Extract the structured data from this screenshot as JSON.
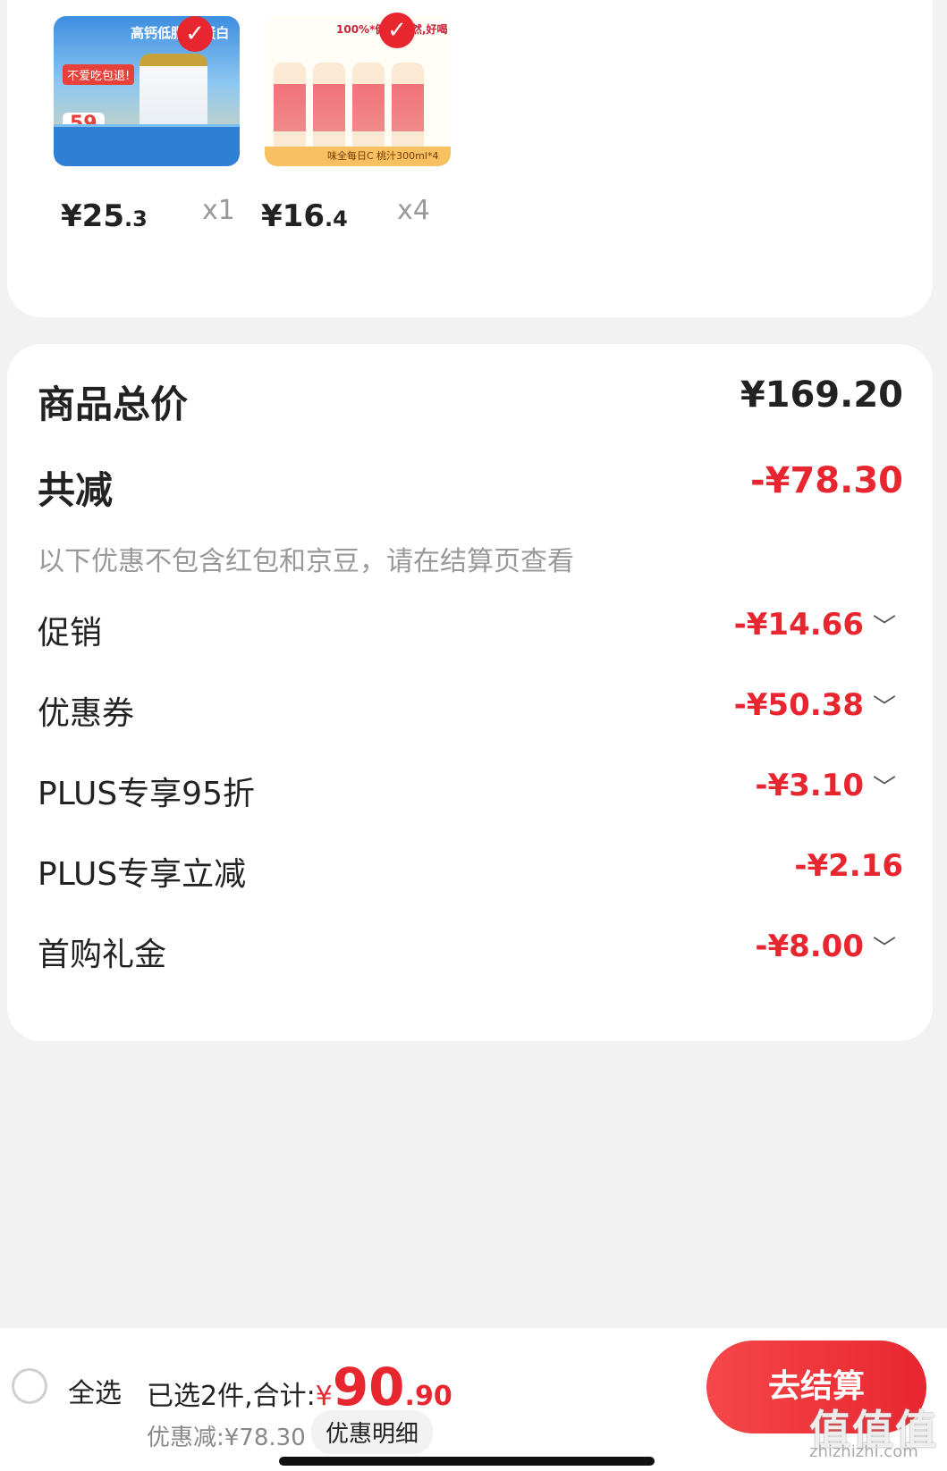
{
  "products": [
    {
      "image_banner": "高钙低脂 高蛋白",
      "image_tag": "不爱吃包退!",
      "image_price": "59",
      "price_int": "¥25",
      "price_dec": ".3",
      "qty": "x1"
    },
    {
      "image_banner": "100%*健康,自然,好喝",
      "image_footer": "味全每日C 桃汁300ml*4",
      "price_int": "¥16",
      "price_dec": ".4",
      "qty": "x4"
    }
  ],
  "summary_card": {
    "total_label": "商品总价",
    "total_value": "¥169.20",
    "reduce_label": "共减",
    "reduce_value": "-¥78.30",
    "note": "以下优惠不包含红包和京豆，请在结算页查看",
    "discounts": [
      {
        "label": "促销",
        "value": "-¥14.66",
        "expandable": true
      },
      {
        "label": "优惠券",
        "value": "-¥50.38",
        "expandable": true
      },
      {
        "label": "PLUS专享95折",
        "value": "-¥3.10",
        "expandable": true
      },
      {
        "label": "PLUS专享立减",
        "value": "-¥2.16",
        "expandable": false
      },
      {
        "label": "首购礼金",
        "value": "-¥8.00",
        "expandable": true
      }
    ]
  },
  "bottom_bar": {
    "select_all": "全选",
    "selected_text": "已选2件,合计:",
    "currency": "¥",
    "total_int": "90",
    "total_dec": ".90",
    "reduced_text": "优惠减:¥78.30",
    "detail_button": "优惠明细",
    "checkout_button": "去结算",
    "watermark": "值值值",
    "watermark_url": "zhizhizhi.com"
  },
  "colors": {
    "accent_red": "#e8262f",
    "background": "#f2f2f2",
    "card": "#ffffff"
  },
  "icons": {
    "check": "checkmark-icon",
    "chevron": "chevron-down-icon"
  }
}
